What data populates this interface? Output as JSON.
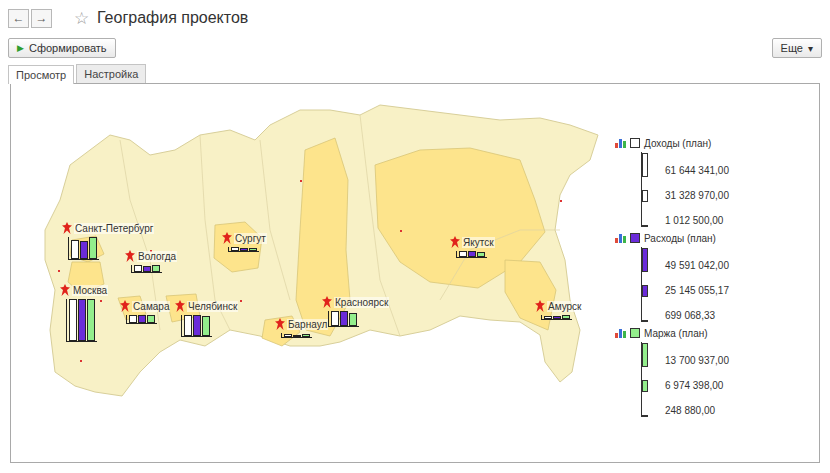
{
  "window": {
    "title": "География проектов",
    "back": "←",
    "forward": "→",
    "favorite": "☆"
  },
  "toolbar": {
    "generate": {
      "icon": "▶",
      "label": "Сформировать"
    },
    "more": {
      "label": "Еще",
      "arrow": "▾"
    }
  },
  "tabs": [
    {
      "label": "Просмотр",
      "selected": true
    },
    {
      "label": "Настройка",
      "selected": false
    }
  ],
  "chart": {
    "series": [
      {
        "name": "Доходы (план)",
        "color": "#ffffff",
        "axis_max": 61644341,
        "ticks": [
          "61 644 341,00",
          "31 328 970,00",
          "1 012 500,00"
        ],
        "tick_values": [
          61644341,
          31328970,
          1012500
        ]
      },
      {
        "name": "Расходы (план)",
        "color": "#6a2bd9",
        "axis_max": 49591042,
        "ticks": [
          "49 591 042,00",
          "25 145 055,17",
          "699 068,33"
        ],
        "tick_values": [
          49591042,
          25145055.17,
          699068.33
        ]
      },
      {
        "name": "Маржа (план)",
        "color": "#93ee8c",
        "axis_max": 13700937,
        "ticks": [
          "13 700 937,00",
          "6 974 398,00",
          "248 880,00"
        ],
        "tick_values": [
          13700937,
          6974398,
          248880
        ]
      }
    ],
    "cities": [
      {
        "name": "Санкт-Петербург",
        "values": [
          28500000,
          21400000,
          7100000
        ]
      },
      {
        "name": "Вологда",
        "values": [
          9800000,
          7600000,
          2200000
        ]
      },
      {
        "name": "Москва",
        "values": [
          61644341,
          49591042,
          13700937
        ]
      },
      {
        "name": "Самара",
        "values": [
          12400000,
          9700000,
          2700000
        ]
      },
      {
        "name": "Челябинск",
        "values": [
          31200000,
          24800000,
          6400000
        ]
      },
      {
        "name": "Сургут",
        "values": [
          5200000,
          4100000,
          1100000
        ]
      },
      {
        "name": "Барнаул",
        "values": [
          3800000,
          2900000,
          900000
        ]
      },
      {
        "name": "Красноярск",
        "values": [
          22600000,
          18300000,
          4300000
        ]
      },
      {
        "name": "Якутск",
        "values": [
          8900000,
          7200000,
          1700000
        ]
      },
      {
        "name": "Амурск",
        "values": [
          4500000,
          3300000,
          1200000
        ]
      }
    ]
  }
}
